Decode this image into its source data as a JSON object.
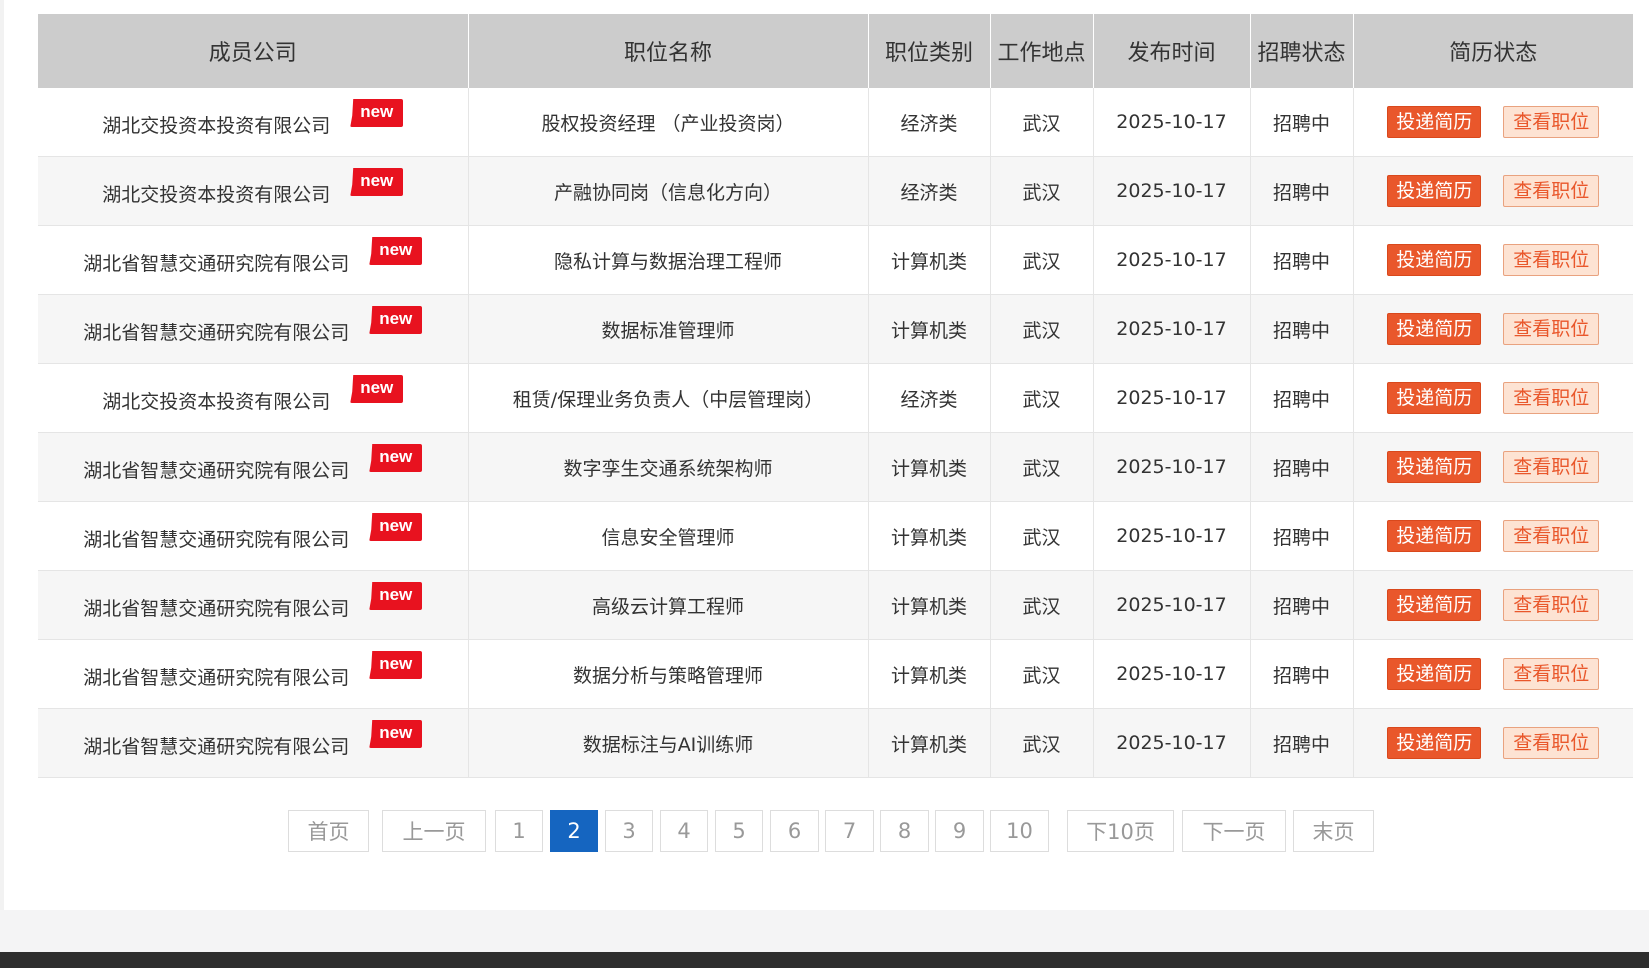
{
  "table": {
    "headers": [
      "成员公司",
      "职位名称",
      "职位类别",
      "工作地点",
      "发布时间",
      "招聘状态",
      "简历状态"
    ],
    "new_badge": "new",
    "apply_label": "投递简历",
    "view_label": "查看职位",
    "rows": [
      {
        "company": "湖北交投资本投资有限公司",
        "position": "股权投资经理 （产业投资岗）",
        "category": "经济类",
        "location": "武汉",
        "date": "2025-10-17",
        "status": "招聘中"
      },
      {
        "company": "湖北交投资本投资有限公司",
        "position": "产融协同岗（信息化方向）",
        "category": "经济类",
        "location": "武汉",
        "date": "2025-10-17",
        "status": "招聘中"
      },
      {
        "company": "湖北省智慧交通研究院有限公司",
        "position": "隐私计算与数据治理工程师",
        "category": "计算机类",
        "location": "武汉",
        "date": "2025-10-17",
        "status": "招聘中"
      },
      {
        "company": "湖北省智慧交通研究院有限公司",
        "position": "数据标准管理师",
        "category": "计算机类",
        "location": "武汉",
        "date": "2025-10-17",
        "status": "招聘中"
      },
      {
        "company": "湖北交投资本投资有限公司",
        "position": "租赁/保理业务负责人（中层管理岗）",
        "category": "经济类",
        "location": "武汉",
        "date": "2025-10-17",
        "status": "招聘中"
      },
      {
        "company": "湖北省智慧交通研究院有限公司",
        "position": "数字孪生交通系统架构师",
        "category": "计算机类",
        "location": "武汉",
        "date": "2025-10-17",
        "status": "招聘中"
      },
      {
        "company": "湖北省智慧交通研究院有限公司",
        "position": "信息安全管理师",
        "category": "计算机类",
        "location": "武汉",
        "date": "2025-10-17",
        "status": "招聘中"
      },
      {
        "company": "湖北省智慧交通研究院有限公司",
        "position": "高级云计算工程师",
        "category": "计算机类",
        "location": "武汉",
        "date": "2025-10-17",
        "status": "招聘中"
      },
      {
        "company": "湖北省智慧交通研究院有限公司",
        "position": "数据分析与策略管理师",
        "category": "计算机类",
        "location": "武汉",
        "date": "2025-10-17",
        "status": "招聘中"
      },
      {
        "company": "湖北省智慧交通研究院有限公司",
        "position": "数据标注与AI训练师",
        "category": "计算机类",
        "location": "武汉",
        "date": "2025-10-17",
        "status": "招聘中"
      }
    ]
  },
  "pagination": {
    "first": "首页",
    "prev": "上一页",
    "pages": [
      "1",
      "2",
      "3",
      "4",
      "5",
      "6",
      "7",
      "8",
      "9",
      "10"
    ],
    "current": "2",
    "next10": "下10页",
    "next": "下一页",
    "last": "末页"
  },
  "colors": {
    "header_bg": "#cccccc",
    "apply_button": "#e9572b",
    "view_button_bg": "#fde3d3",
    "new_badge": "#e8121f",
    "active_page": "#1565c0"
  }
}
